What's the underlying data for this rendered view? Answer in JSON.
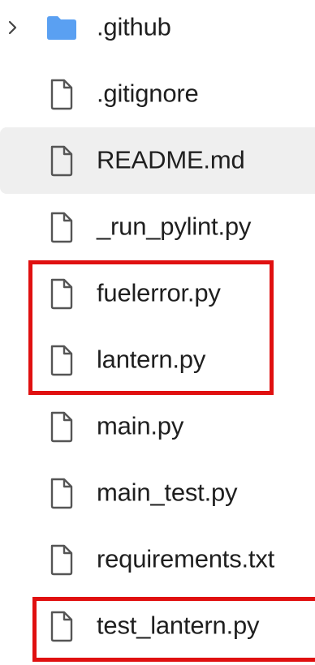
{
  "file_tree": {
    "items": [
      {
        "name": ".github",
        "type": "folder",
        "icon": "folder-icon",
        "expandable": true,
        "selected": false
      },
      {
        "name": ".gitignore",
        "type": "file",
        "icon": "file-icon",
        "selected": false
      },
      {
        "name": "README.md",
        "type": "file",
        "icon": "file-icon",
        "selected": true
      },
      {
        "name": "_run_pylint.py",
        "type": "file",
        "icon": "file-icon",
        "selected": false
      },
      {
        "name": "fuelerror.py",
        "type": "file",
        "icon": "file-icon",
        "selected": false
      },
      {
        "name": "lantern.py",
        "type": "file",
        "icon": "file-icon",
        "selected": false
      },
      {
        "name": "main.py",
        "type": "file",
        "icon": "file-icon",
        "selected": false
      },
      {
        "name": "main_test.py",
        "type": "file",
        "icon": "file-icon",
        "selected": false
      },
      {
        "name": "requirements.txt",
        "type": "file",
        "icon": "file-icon",
        "selected": false
      },
      {
        "name": "test_lantern.py",
        "type": "file",
        "icon": "file-icon",
        "selected": false
      }
    ]
  },
  "annotations": {
    "color": "#e01010",
    "highlighted_items": [
      "fuelerror.py",
      "lantern.py",
      "test_lantern.py"
    ]
  },
  "colors": {
    "folder": "#5aa0f2",
    "file_icon": "#555555",
    "text": "#1f1f1f",
    "selected_bg": "#efefef"
  }
}
